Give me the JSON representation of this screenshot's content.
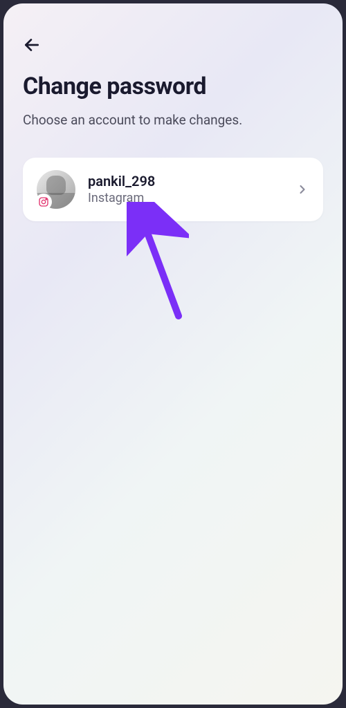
{
  "header": {
    "title": "Change password",
    "subtitle": "Choose an account to make changes."
  },
  "accounts": [
    {
      "username": "pankil_298",
      "platform": "Instagram"
    }
  ]
}
